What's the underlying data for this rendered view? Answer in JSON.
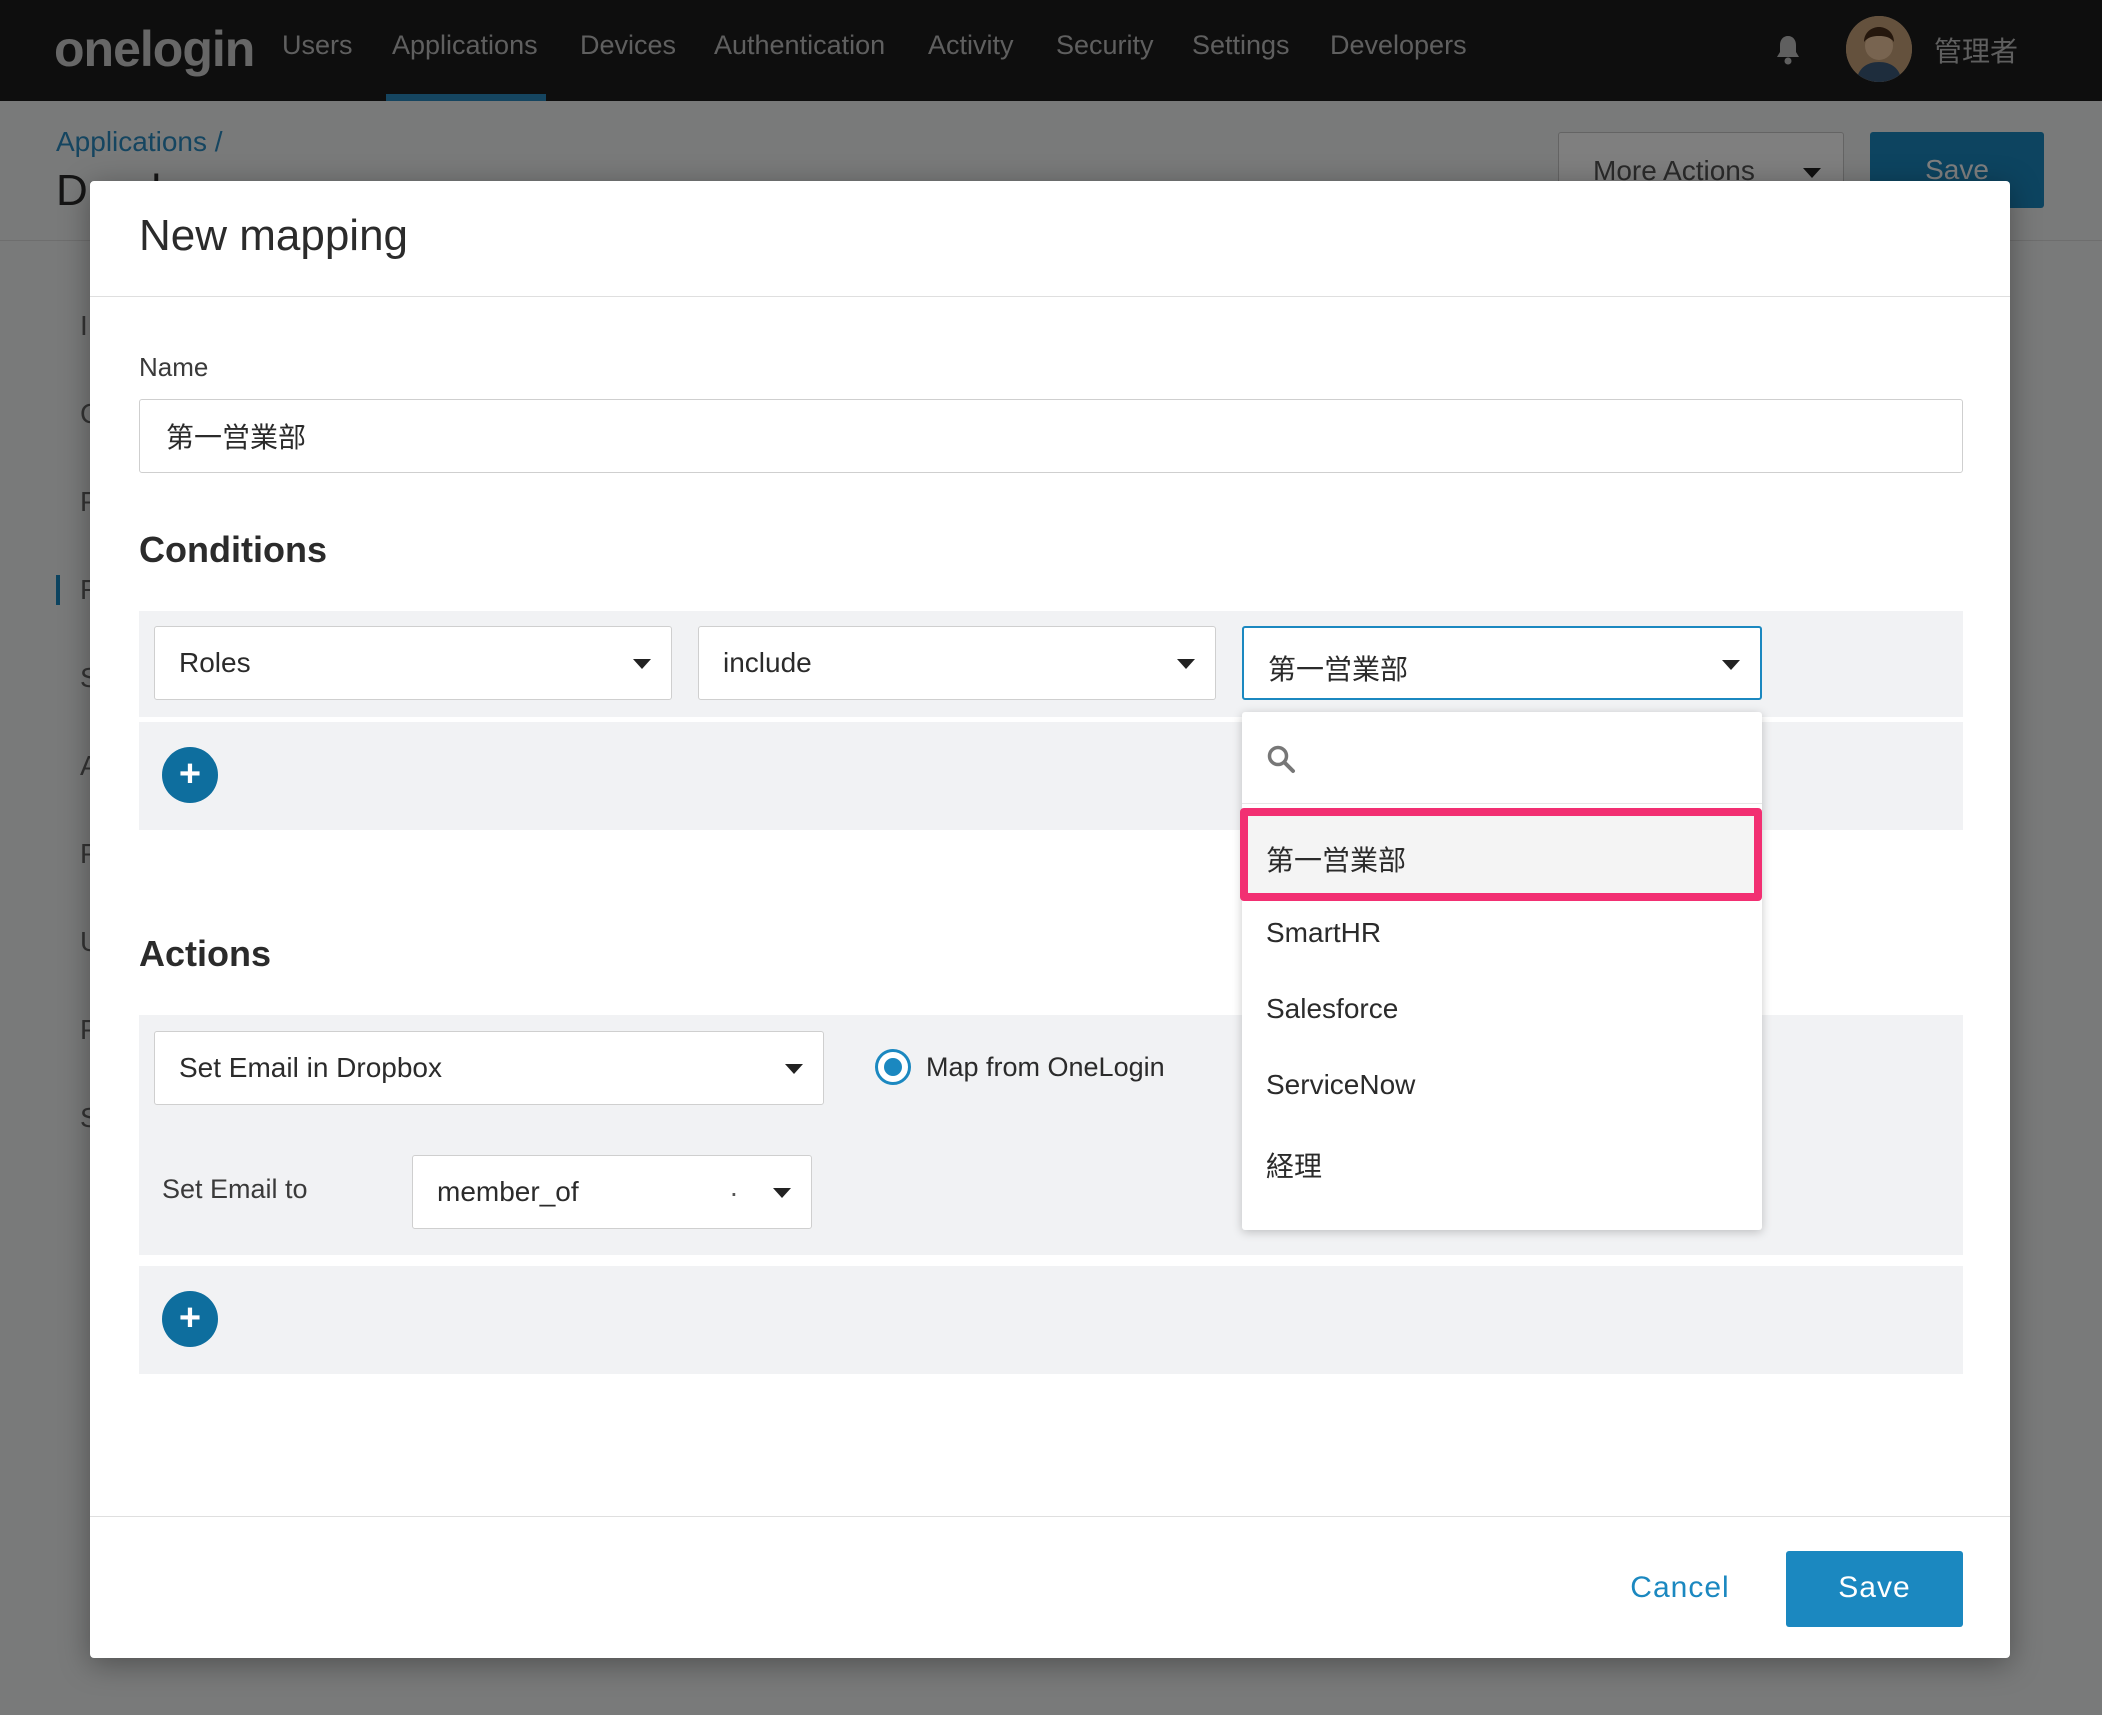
{
  "app": {
    "logo": "onelogin",
    "nav": [
      "Users",
      "Applications",
      "Devices",
      "Authentication",
      "Activity",
      "Security",
      "Settings",
      "Developers"
    ],
    "user_name": "管理者"
  },
  "page": {
    "breadcrumb": "Applications /",
    "title": "Dropbox",
    "more_actions_label": "More Actions",
    "save_label": "Save",
    "side_letters": [
      "I",
      "C",
      "P",
      "R",
      "S",
      "A",
      "P",
      "U",
      "P",
      "S"
    ]
  },
  "modal": {
    "title": "New mapping",
    "name_label": "Name",
    "name_value": "第一営業部",
    "conditions_title": "Conditions",
    "condition": {
      "field": "Roles",
      "operator": "include",
      "value": "第一営業部"
    },
    "actions_title": "Actions",
    "action": {
      "target": "Set Email in Dropbox",
      "radio_label": "Map from OneLogin",
      "set_label": "Set Email to",
      "set_value": "member_of",
      "suffix": "."
    },
    "add_icon": "+",
    "cancel_label": "Cancel",
    "save_label": "Save"
  },
  "dropdown": {
    "search_placeholder": "",
    "options": [
      "第一営業部",
      "SmartHR",
      "Salesforce",
      "ServiceNow",
      "経理"
    ],
    "selected_index": 0
  },
  "colors": {
    "accent": "#1b88c0",
    "highlight": "#f22f72",
    "nav_bg": "#1c1c1c"
  }
}
